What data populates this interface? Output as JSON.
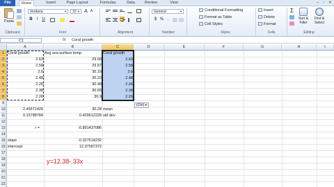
{
  "tabs": [
    "File",
    "Home",
    "Insert",
    "Page Layout",
    "Formulas",
    "Data",
    "Review",
    "View"
  ],
  "active_tab": "Home",
  "window_controls": [
    "–",
    "▫",
    "✕"
  ],
  "clipboard": {
    "paste": "Paste",
    "group": "Clipboard"
  },
  "font": {
    "name": "Verdana",
    "size": "10",
    "group": "Font",
    "bold": "B",
    "italic": "I",
    "underline": "U",
    "grow": "A",
    "shrink": "A"
  },
  "alignment": {
    "group": "Alignment"
  },
  "number": {
    "format": "General",
    "currency": "$",
    "percent": "%",
    "comma": ",",
    "group": "Number"
  },
  "styles": {
    "cond": "Conditional Formatting",
    "table": "Format as Table",
    "cell": "Cell Styles",
    "group": "Styles"
  },
  "cells": {
    "insert": "Insert",
    "delete": "Delete",
    "format": "Format",
    "group": "Cells"
  },
  "editing": {
    "sum": "Σ",
    "sort": "Sort &",
    "sort2": "Filter",
    "find": "Find &",
    "find2": "Select",
    "group": "Editing"
  },
  "formula_bar": {
    "name_box": "C1",
    "fx": "fx",
    "value": "Coral growth"
  },
  "columns": [
    "A",
    "B",
    "C",
    "D",
    "E",
    "F",
    "G",
    "H",
    "I"
  ],
  "rows": [
    "1",
    "2",
    "3",
    "4",
    "5",
    "6",
    "7",
    "8",
    "9",
    "10",
    "11",
    "12",
    "13",
    "14",
    "15",
    "16",
    "17",
    "18",
    "19",
    "20",
    "21",
    "22"
  ],
  "sheet": {
    "a1": "Coral growth",
    "b1": "Avg sea surface temp",
    "c1": "Coral growth",
    "a": [
      "2.63",
      "2.58",
      "2.6",
      "2.48",
      "2.26",
      "2.38",
      "2.26"
    ],
    "b": [
      "29.68",
      "29.87",
      "30.16",
      "30.22",
      "30.48",
      "30.65",
      "30.9"
    ],
    "c": [
      "2.63",
      "2.58",
      "2.6",
      "2.48",
      "2.26",
      "2.38",
      "2.26"
    ],
    "a10": "2.45571429",
    "b10": "30.28",
    "c10": "mean",
    "a11": "0.15788784",
    "b11": "0.429612228",
    "c11": "std dev",
    "a13": "r =",
    "b13": "-0.891437086",
    "a15": "slope",
    "b15": "-0.327614232",
    "a16": "intercept",
    "b16": "12.37587372"
  },
  "paste_options": "(Ctrl) ▾",
  "equation": "y=12.38-.33x"
}
